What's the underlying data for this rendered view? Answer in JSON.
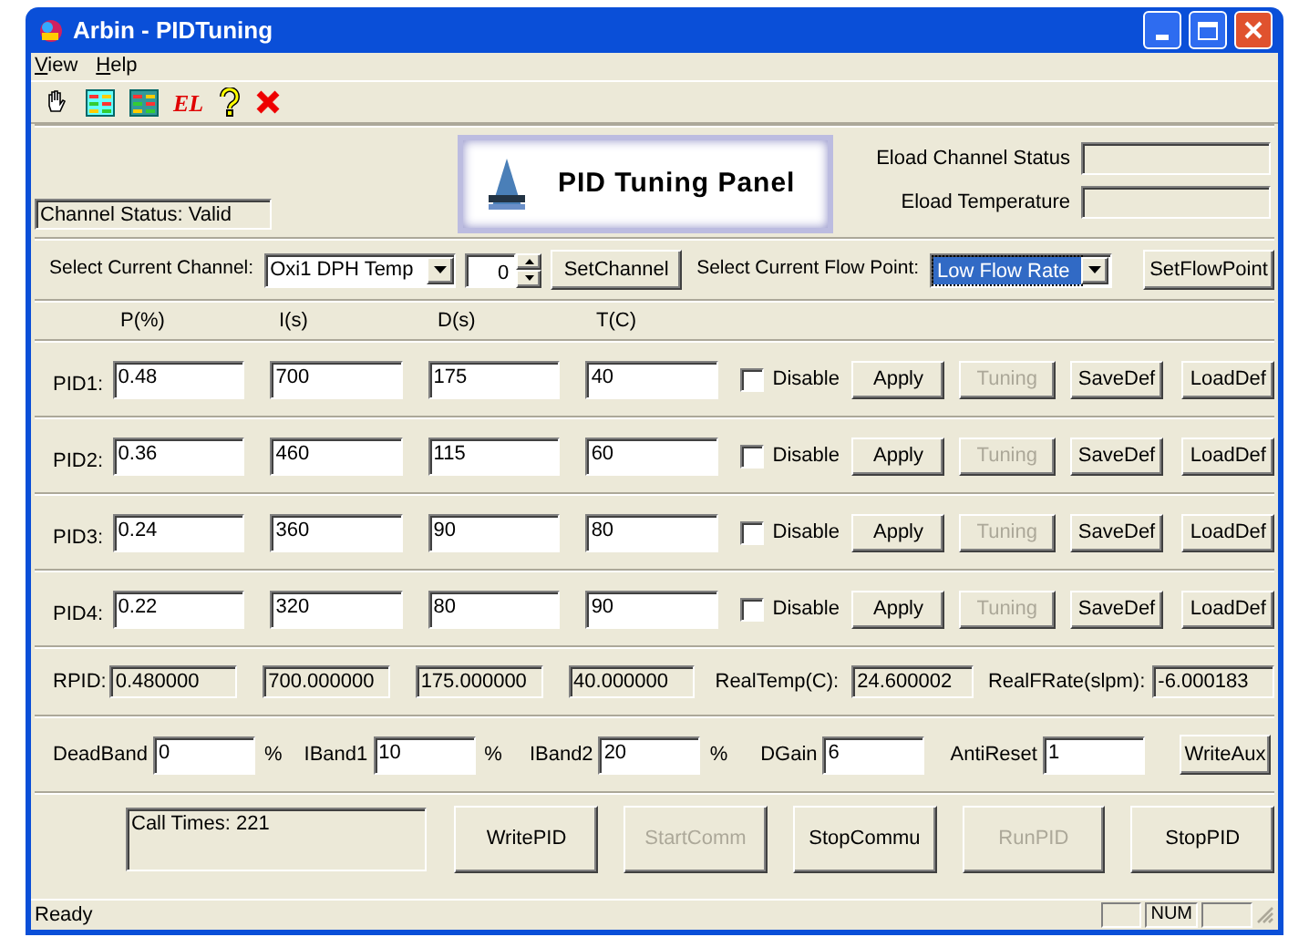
{
  "window": {
    "title": "Arbin - PIDTuning"
  },
  "menu": [
    {
      "label": "View"
    },
    {
      "label": "Help"
    }
  ],
  "toolbar": [
    {
      "kind": "hand"
    },
    {
      "kind": "grid"
    },
    {
      "kind": "grid-dark"
    },
    {
      "kind": "text",
      "label": "EL"
    },
    {
      "kind": "help"
    },
    {
      "kind": "delete"
    }
  ],
  "header": {
    "channel_status": "Channel Status: Valid",
    "panel_title": "PID Tuning Panel",
    "eload_fields": [
      {
        "label": "Eload Channel Status"
      },
      {
        "label": "Eload Temperature"
      }
    ]
  },
  "channel_select": {
    "label": "Select Current Channel:",
    "value": "Oxi1 DPH Temp",
    "spin_value": "0",
    "button": "SetChannel"
  },
  "flow_select": {
    "label": "Select Current Flow Point:",
    "value": "Low Flow Rate",
    "focused": true,
    "button": "SetFlowPoint"
  },
  "columns": [
    "P(%)",
    "I(s)",
    "D(s)",
    "T(C)"
  ],
  "pid_rows": [
    {
      "label": "PID1:",
      "values": [
        "0.48",
        "700",
        "175",
        "40"
      ],
      "disable": {
        "label": "Disable",
        "checked": false
      },
      "buttons": [
        {
          "label": "Apply",
          "disabled": false
        },
        {
          "label": "Tuning",
          "disabled": true
        },
        {
          "label": "SaveDef",
          "disabled": false
        },
        {
          "label": "LoadDef",
          "disabled": false
        }
      ]
    },
    {
      "label": "PID2:",
      "values": [
        "0.36",
        "460",
        "115",
        "60"
      ],
      "disable": {
        "label": "Disable",
        "checked": false
      },
      "buttons": [
        {
          "label": "Apply",
          "disabled": false
        },
        {
          "label": "Tuning",
          "disabled": true
        },
        {
          "label": "SaveDef",
          "disabled": false
        },
        {
          "label": "LoadDef",
          "disabled": false
        }
      ]
    },
    {
      "label": "PID3:",
      "values": [
        "0.24",
        "360",
        "90",
        "80"
      ],
      "disable": {
        "label": "Disable",
        "checked": false
      },
      "buttons": [
        {
          "label": "Apply",
          "disabled": false
        },
        {
          "label": "Tuning",
          "disabled": true
        },
        {
          "label": "SaveDef",
          "disabled": false
        },
        {
          "label": "LoadDef",
          "disabled": false
        }
      ]
    },
    {
      "label": "PID4:",
      "values": [
        "0.22",
        "320",
        "80",
        "90"
      ],
      "disable": {
        "label": "Disable",
        "checked": false
      },
      "buttons": [
        {
          "label": "Apply",
          "disabled": false
        },
        {
          "label": "Tuning",
          "disabled": true
        },
        {
          "label": "SaveDef",
          "disabled": false
        },
        {
          "label": "LoadDef",
          "disabled": false
        }
      ]
    }
  ],
  "rpid": {
    "label": "RPID:",
    "values": [
      "0.480000",
      "700.000000",
      "175.000000",
      "40.000000"
    ],
    "readings": [
      {
        "label": "RealTemp(C):",
        "value": "24.600002"
      },
      {
        "label": "RealFRate(slpm):",
        "value": "-6.000183"
      }
    ]
  },
  "aux": {
    "fields": [
      {
        "label": "DeadBand",
        "value": "0",
        "unit": "%"
      },
      {
        "label": "IBand1",
        "value": "10",
        "unit": "%"
      },
      {
        "label": "IBand2",
        "value": "20",
        "unit": "%"
      },
      {
        "label": "DGain",
        "value": "6"
      },
      {
        "label": "AntiReset",
        "value": "1"
      }
    ],
    "button": "WriteAux"
  },
  "call_times": "Call Times: 221",
  "actions": [
    {
      "label": "WritePID",
      "disabled": false
    },
    {
      "label": "StartComm",
      "disabled": true
    },
    {
      "label": "StopCommu",
      "disabled": false
    },
    {
      "label": "RunPID",
      "disabled": true
    },
    {
      "label": "StopPID",
      "disabled": false
    }
  ],
  "status_bar": {
    "text": "Ready",
    "indicators": [
      "NUM"
    ]
  }
}
